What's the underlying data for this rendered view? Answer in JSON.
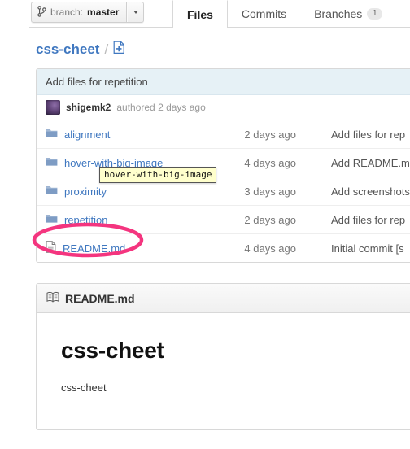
{
  "topbar": {
    "branch": {
      "icon": "git-branch-icon",
      "prefix": "branch:",
      "name": "master",
      "caret": "chevron-down-icon"
    },
    "tabs": [
      {
        "label": "Files",
        "active": true
      },
      {
        "label": "Commits",
        "active": false
      },
      {
        "label": "Branches",
        "active": false,
        "badge": "1"
      }
    ]
  },
  "breadcrumb": {
    "repo": "css-cheet",
    "separator": "/",
    "add_file_icon": "new-file-icon"
  },
  "filelist": {
    "latest_commit_message": "Add files for repetition",
    "author": "shigemk2",
    "author_suffix": "authored 2 days ago",
    "columns": [
      "name",
      "age",
      "message"
    ],
    "rows": [
      {
        "icon": "folder-icon",
        "name": "alignment",
        "age": "2 days ago",
        "message": "Add files for rep",
        "hovered": false,
        "annotated": false
      },
      {
        "icon": "folder-icon",
        "name": "hover-with-big-image",
        "age": "4 days ago",
        "message": "Add README.m",
        "hovered": true,
        "annotated": false
      },
      {
        "icon": "folder-icon",
        "name": "proximity",
        "age": "3 days ago",
        "message": "Add screenshots",
        "hovered": false,
        "annotated": false
      },
      {
        "icon": "folder-icon",
        "name": "repetition",
        "age": "2 days ago",
        "message": "Add files for rep",
        "hovered": false,
        "annotated": false
      },
      {
        "icon": "file-icon",
        "name": "README.md",
        "age": "4 days ago",
        "message": "Initial commit [s",
        "message_link": "[s",
        "hovered": false,
        "annotated": true
      }
    ]
  },
  "tooltip": {
    "text": "hover-with-big-image"
  },
  "annotation": {
    "shape": "ellipse",
    "color": "#f4357f",
    "target": "README.md"
  },
  "readme": {
    "icon": "book-icon",
    "title": "README.md",
    "heading": "css-cheet",
    "paragraph": "css-cheet"
  },
  "colors": {
    "link": "#4078c0",
    "commit_bar": "#e6f1f6",
    "annotation": "#f4357f",
    "tooltip_bg": "#ffffcc",
    "folder": "#7e9cc4"
  }
}
